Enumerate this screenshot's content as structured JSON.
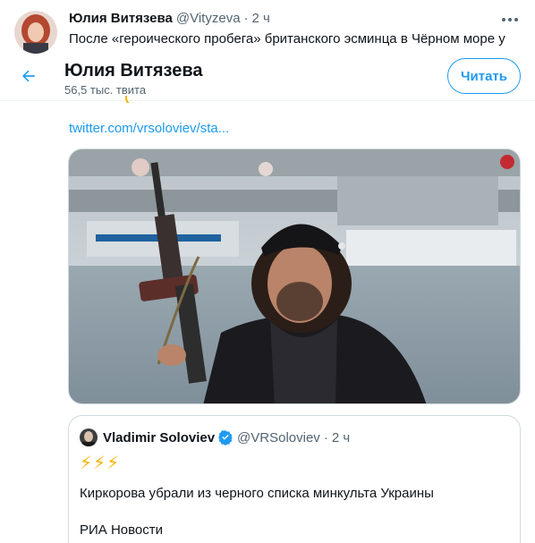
{
  "background_tweet": {
    "author_name": "Юлия Витязева",
    "handle": "@Vityzeva",
    "separator": "·",
    "time": "2 ч",
    "text": "После «героического пробега»  британского эсминца в Чёрном море у",
    "more_icon": "more-horizontal-icon"
  },
  "profile_header": {
    "name": "Юлия Витязева",
    "tweet_count": "56,5 тыс. твита",
    "follow_label": "Читать",
    "back_icon": "arrow-left-icon"
  },
  "tweet": {
    "link_text": "twitter.com/vrsoloviev/sta...",
    "media": {
      "description_icon": "photo-man-with-rifle"
    }
  },
  "quote": {
    "author_name": "Vladimir Soloviev",
    "handle": "@VRSoloviev",
    "separator": "·",
    "time": "2 ч",
    "bolts": "⚡⚡⚡",
    "line1": "Киркорова убрали из черного списка минкульта Украины",
    "line2": "РИА Новости",
    "verified_icon": "verified-badge-icon"
  },
  "colors": {
    "accent": "#1d9bf0",
    "text": "#0f1419",
    "muted": "#536471",
    "border": "#cfd9de"
  }
}
